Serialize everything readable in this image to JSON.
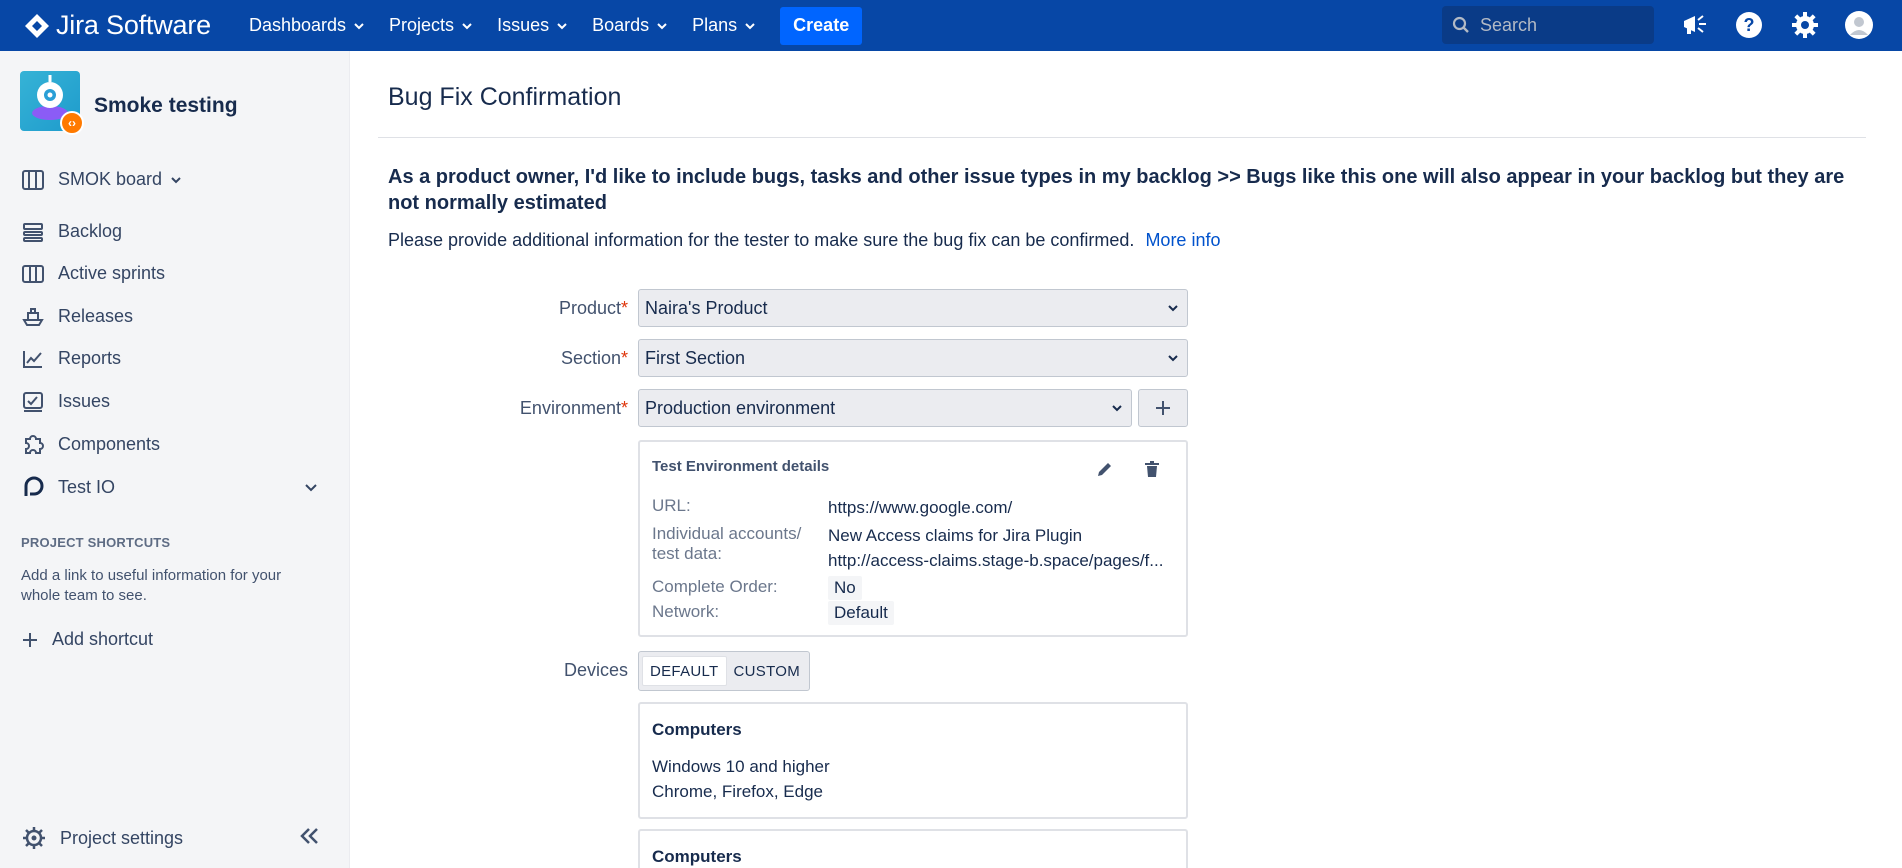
{
  "topnav": {
    "brand": "Jira Software",
    "items": [
      {
        "label": "Dashboards"
      },
      {
        "label": "Projects"
      },
      {
        "label": "Issues"
      },
      {
        "label": "Boards"
      },
      {
        "label": "Plans"
      }
    ],
    "create_label": "Create",
    "search_placeholder": "Search"
  },
  "sidebar": {
    "project_name": "Smoke testing",
    "board_label": "SMOK board",
    "items": [
      {
        "label": "Backlog",
        "icon": "backlog-icon"
      },
      {
        "label": "Active sprints",
        "icon": "board-columns-icon"
      },
      {
        "label": "Releases",
        "icon": "ship-icon"
      },
      {
        "label": "Reports",
        "icon": "chart-line-icon"
      },
      {
        "label": "Issues",
        "icon": "issues-icon"
      },
      {
        "label": "Components",
        "icon": "puzzle-icon"
      },
      {
        "label": "Test IO",
        "icon": "testio-icon"
      }
    ],
    "shortcuts_heading": "PROJECT SHORTCUTS",
    "shortcuts_help": "Add a link to useful information for your whole team to see.",
    "add_shortcut": "Add shortcut",
    "settings_label": "Project settings"
  },
  "main": {
    "title": "Bug Fix Confirmation",
    "story": "As a product owner, I'd like to include bugs, tasks and other issue types in my backlog >> Bugs like this one will also appear in your backlog but they are not normally estimated",
    "hint": "Please provide additional information for the tester to make sure the bug fix can be confirmed.",
    "more_info": "More info",
    "form": {
      "product_label": "Product",
      "product_value": "Naira's Product",
      "section_label": "Section",
      "section_value": "First Section",
      "environment_label": "Environment",
      "environment_value": "Production environment",
      "required_mark": "*"
    },
    "env_card": {
      "title": "Test Environment details",
      "url_key": "URL:",
      "url_value": "https://www.google.com/",
      "accounts_key_1": "Individual accounts/",
      "accounts_key_2": "test data:",
      "accounts_value_1": "New Access claims for Jira Plugin",
      "accounts_value_2": "http://access-claims.stage-b.space/pages/f...",
      "order_key": "Complete Order:",
      "order_value": "No",
      "network_key": "Network:",
      "network_value": "Default"
    },
    "devices": {
      "label": "Devices",
      "default_label": "DEFAULT",
      "custom_label": "CUSTOM",
      "cards": [
        {
          "title": "Computers",
          "line1": "Windows 10 and higher",
          "line2": "Chrome, Firefox, Edge"
        },
        {
          "title": "Computers"
        }
      ]
    }
  },
  "colors": {
    "nav_bg": "#0747a6",
    "create_btn": "#0065ff",
    "link": "#0052cc",
    "required": "#de350b"
  }
}
